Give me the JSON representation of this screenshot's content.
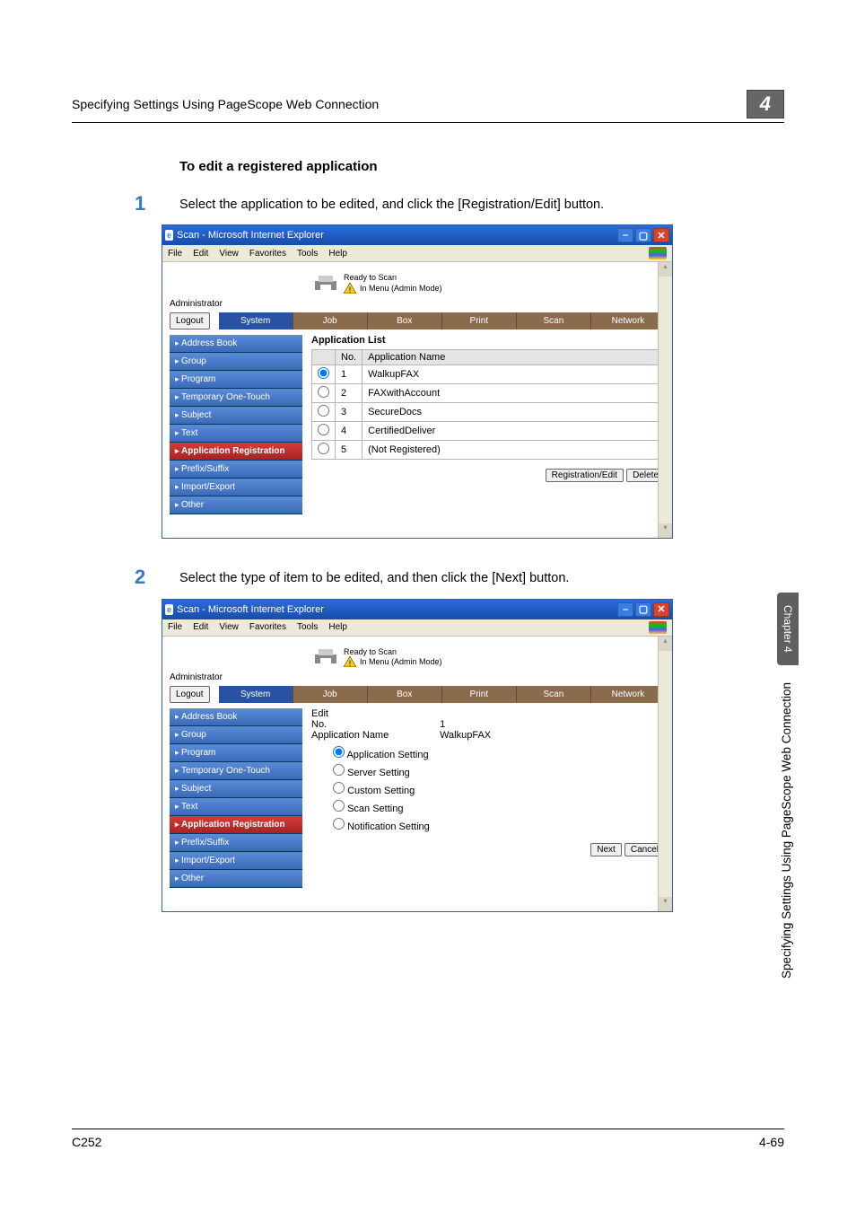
{
  "page": {
    "header_title": "Specifying Settings Using PageScope Web Connection",
    "chapter_number": "4",
    "section_heading": "To edit a registered application"
  },
  "steps": {
    "s1": {
      "num": "1",
      "text": "Select the application to be edited, and click the [Registration/Edit] button."
    },
    "s2": {
      "num": "2",
      "text": "Select the type of item to be edited, and then click the [Next] button."
    }
  },
  "ie": {
    "window_title": "Scan - Microsoft Internet Explorer",
    "menus": [
      "File",
      "Edit",
      "View",
      "Favorites",
      "Tools",
      "Help"
    ],
    "status_top": "Ready to Scan",
    "status_bottom": "In Menu (Admin Mode)",
    "admin_label": "Administrator",
    "logout": "Logout",
    "tabs": [
      "System",
      "Job",
      "Box",
      "Print",
      "Scan",
      "Network"
    ],
    "sidebar": [
      "Address Book",
      "Group",
      "Program",
      "Temporary One-Touch",
      "Subject",
      "Text",
      "Application Registration",
      "Prefix/Suffix",
      "Import/Export",
      "Other"
    ]
  },
  "screen1": {
    "list_title": "Application List",
    "col_no": "No.",
    "col_name": "Application Name",
    "rows": [
      {
        "no": "1",
        "name": "WalkupFAX"
      },
      {
        "no": "2",
        "name": "FAXwithAccount"
      },
      {
        "no": "3",
        "name": "SecureDocs"
      },
      {
        "no": "4",
        "name": "CertifiedDeliver"
      },
      {
        "no": "5",
        "name": "(Not Registered)"
      }
    ],
    "btn_reg": "Registration/Edit",
    "btn_del": "Delete"
  },
  "screen2": {
    "edit_title": "Edit",
    "no_label": "No.",
    "no_value": "1",
    "appname_label": "Application Name",
    "appname_value": "WalkupFAX",
    "opts": [
      "Application Setting",
      "Server Setting",
      "Custom Setting",
      "Scan Setting",
      "Notification Setting"
    ],
    "btn_next": "Next",
    "btn_cancel": "Cancel"
  },
  "side": {
    "chapter_tab": "Chapter 4",
    "chapter_title": "Specifying Settings Using PageScope Web Connection"
  },
  "footer": {
    "left": "C252",
    "right": "4-69"
  }
}
